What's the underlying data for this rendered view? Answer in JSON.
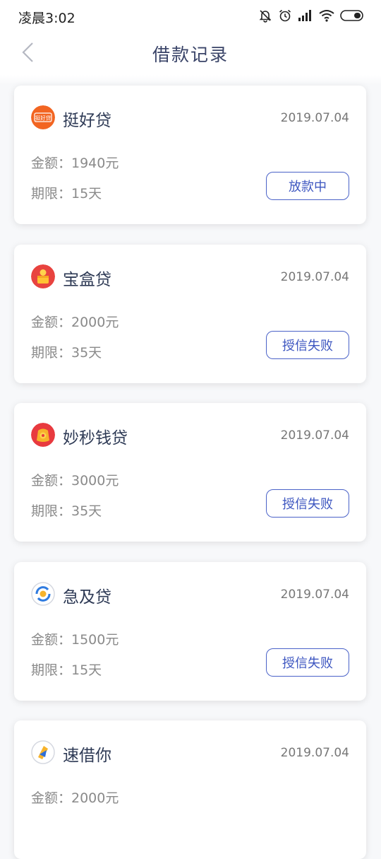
{
  "status_bar": {
    "time": "凌晨3:02"
  },
  "nav": {
    "title": "借款记录"
  },
  "colors": {
    "accent": "#3d56c0",
    "title": "#3a4468"
  },
  "records": [
    {
      "name": "挺好贷",
      "date": "2019.07.04",
      "amount": "金额：1940元",
      "term": "期限：15天",
      "status": "放款中",
      "logo_icon": "tinghaodai-logo-icon",
      "logo_text": "挺好贷"
    },
    {
      "name": "宝盒贷",
      "date": "2019.07.04",
      "amount": "金额：2000元",
      "term": "期限：35天",
      "status": "授信失败",
      "logo_icon": "baohedai-logo-icon"
    },
    {
      "name": "妙秒钱贷",
      "date": "2019.07.04",
      "amount": "金额：3000元",
      "term": "期限：35天",
      "status": "授信失败",
      "logo_icon": "miaomiaoqiandai-logo-icon"
    },
    {
      "name": "急及贷",
      "date": "2019.07.04",
      "amount": "金额：1500元",
      "term": "期限：15天",
      "status": "授信失败",
      "logo_icon": "jijidai-logo-icon"
    },
    {
      "name": "速借你",
      "date": "2019.07.04",
      "amount": "金额：2000元",
      "logo_icon": "sujieni-logo-icon"
    }
  ]
}
